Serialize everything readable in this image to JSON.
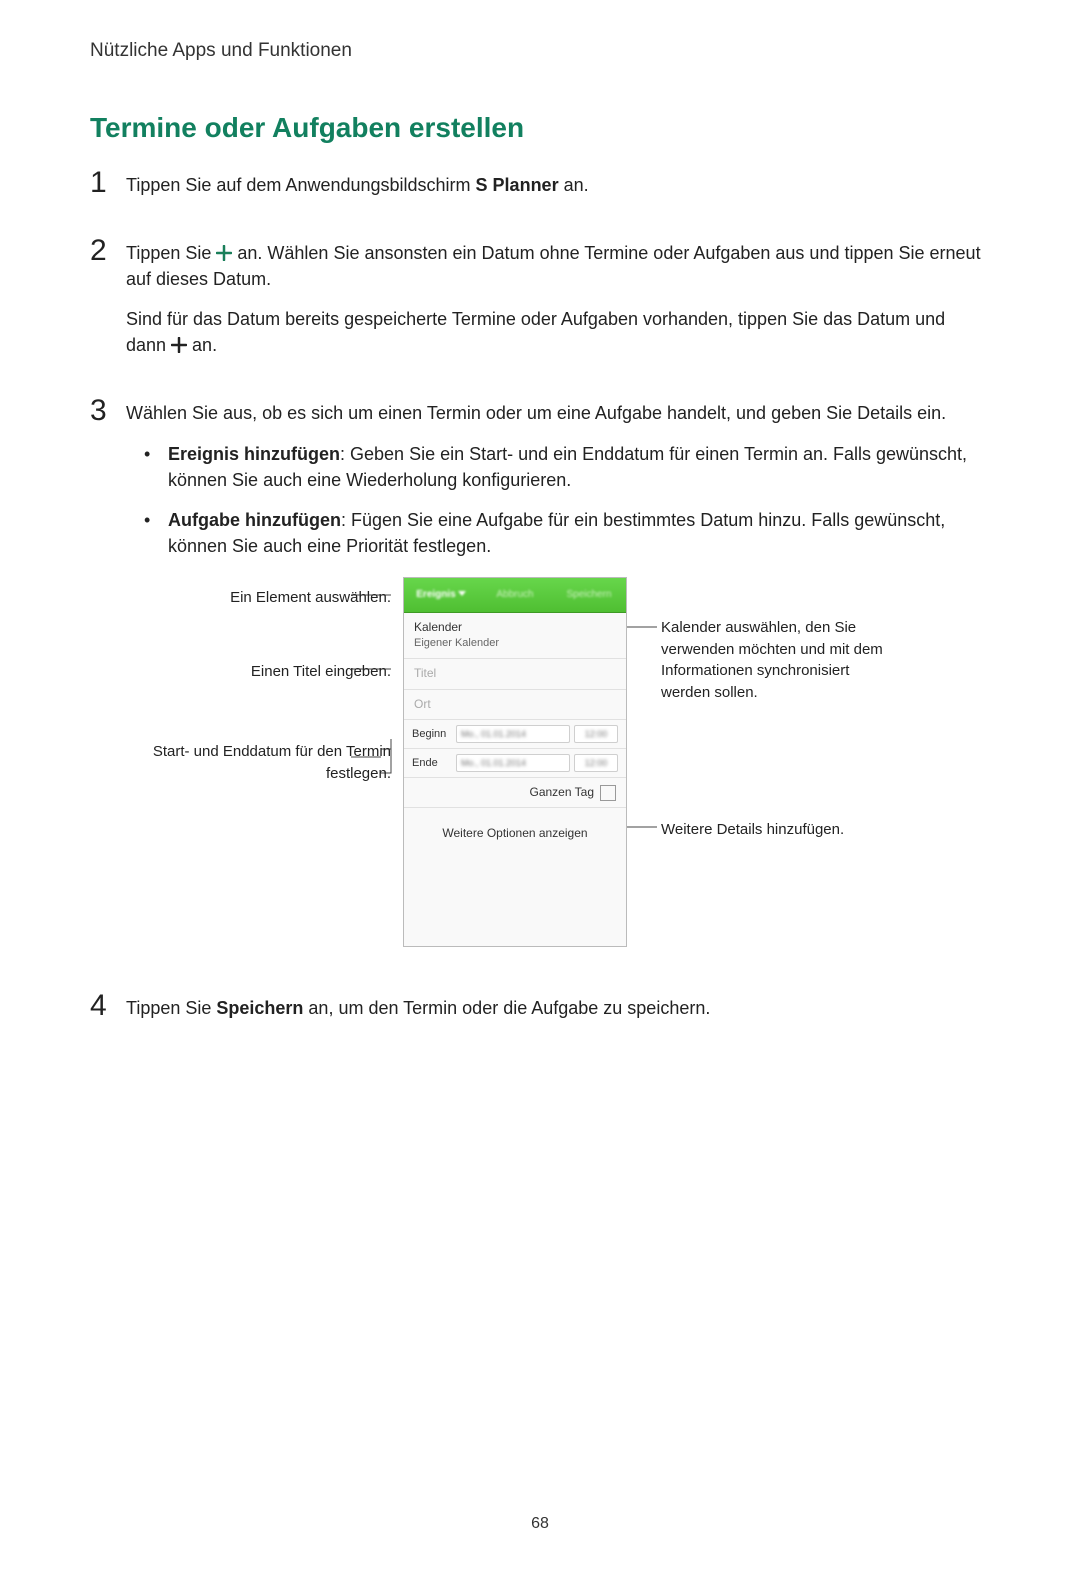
{
  "chapter": "Nützliche Apps und Funktionen",
  "title": "Termine oder Aufgaben erstellen",
  "steps": {
    "s1": {
      "num": "1",
      "pre": "Tippen Sie auf dem Anwendungsbildschirm ",
      "bold": "S Planner",
      "post": " an."
    },
    "s2": {
      "num": "2",
      "p1_pre": "Tippen Sie ",
      "p1_post": " an. Wählen Sie ansonsten ein Datum ohne Termine oder Aufgaben aus und tippen Sie erneut auf dieses Datum.",
      "p2_pre": "Sind für das Datum bereits gespeicherte Termine oder Aufgaben vorhanden, tippen Sie das Datum und dann ",
      "p2_post": " an."
    },
    "s3": {
      "num": "3",
      "intro": "Wählen Sie aus, ob es sich um einen Termin oder um eine Aufgabe handelt, und geben Sie Details ein.",
      "b1_bold": "Ereignis hinzufügen",
      "b1_text": ": Geben Sie ein Start- und ein Enddatum für einen Termin an. Falls gewünscht, können Sie auch eine Wiederholung konfigurieren.",
      "b2_bold": "Aufgabe hinzufügen",
      "b2_text": ": Fügen Sie eine Aufgabe für ein bestimmtes Datum hinzu. Falls gewünscht, können Sie auch eine Priorität festlegen."
    },
    "s4": {
      "num": "4",
      "pre": "Tippen Sie ",
      "bold": "Speichern",
      "post": " an, um den Termin oder die Aufgabe zu speichern."
    }
  },
  "callouts": {
    "left1": "Ein Element auswählen.",
    "left2": "Einen Titel eingeben.",
    "left3": "Start- und Enddatum für den Termin festlegen.",
    "right1": "Kalender auswählen, den Sie verwenden möchten und mit dem Informationen synchronisiert werden sollen.",
    "right2": "Weitere Details hinzufügen."
  },
  "phone": {
    "tab_active": "Ereignis",
    "tab_cancel": "Abbruch",
    "tab_save": "Speichern",
    "cal_label": "Kalender",
    "cal_value": "Eigener Kalender",
    "title_ph": "Titel",
    "loc_ph": "Ort",
    "begin": "Beginn",
    "end": "Ende",
    "date_blur": "Mo., 01.01.2014",
    "time_blur": "12:00",
    "allday": "Ganzen Tag",
    "more": "Weitere Optionen anzeigen"
  },
  "page_number": "68"
}
